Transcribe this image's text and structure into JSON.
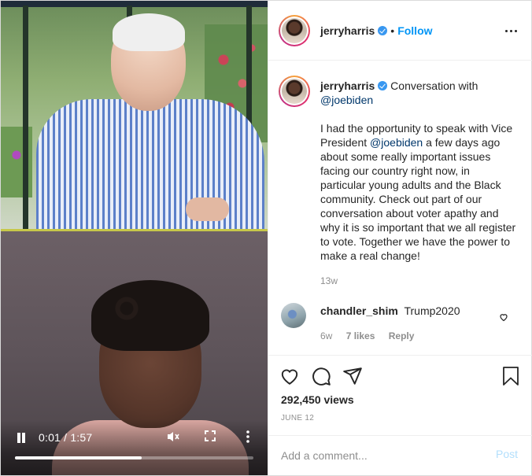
{
  "post": {
    "author": "jerryharris",
    "verified": true,
    "follow_label": "Follow",
    "separator": "•"
  },
  "video": {
    "time_display": "0:01 / 1:57",
    "progress": 0.53,
    "muted": true
  },
  "caption": {
    "author": "jerryharris",
    "intro": "Conversation with",
    "mention": "@joebiden",
    "body_before": "I had the opportunity to speak with Vice President ",
    "body_mention": "@joebiden",
    "body_after": " a few days ago about some really important issues facing our country right now, in particular young adults and the Black community. Check out part of our conversation about voter apathy and why it is so important that we all register to vote. Together we have the power to make a real change!",
    "age": "13w"
  },
  "comment": {
    "author": "chandler_shim",
    "text": "Trump2020",
    "age": "6w",
    "likes": "7 likes",
    "reply_label": "Reply"
  },
  "stats": {
    "views": "292,450 views",
    "date": "JUNE 12"
  },
  "composer": {
    "placeholder": "Add a comment...",
    "post_label": "Post"
  },
  "icons": {
    "like": "heart-icon",
    "comment": "comment-icon",
    "share": "share-icon",
    "save": "bookmark-icon",
    "more": "more-horizontal-icon"
  },
  "colors": {
    "link": "#0095f6",
    "mention": "#00376b",
    "muted_text": "#8e8e8e",
    "verified": "#3897f0",
    "post_disabled": "#b2dffc"
  }
}
